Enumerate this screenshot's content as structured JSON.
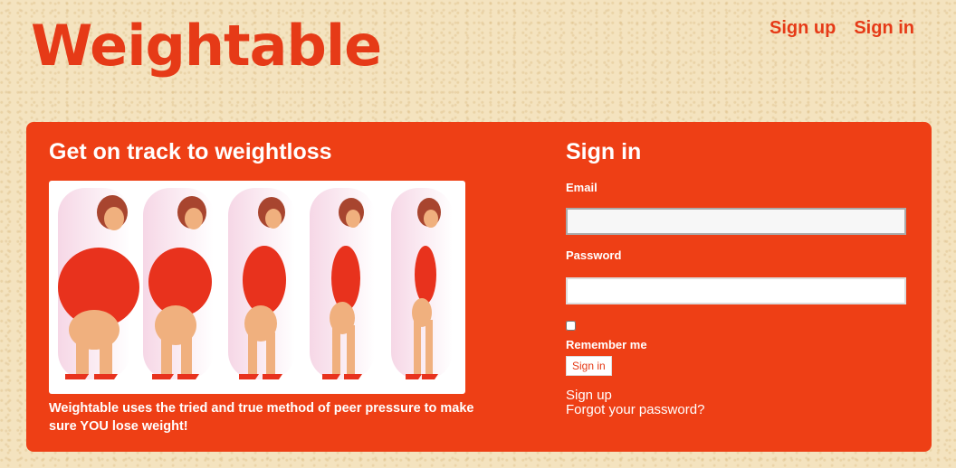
{
  "brand": {
    "name": "Weightable"
  },
  "topnav": {
    "signup": "Sign up",
    "signin": "Sign in"
  },
  "promo": {
    "heading": "Get on track to weightloss",
    "tagline": "Weightable uses the tried and true method of peer pressure to make sure YOU lose weight!"
  },
  "signin": {
    "heading": "Sign in",
    "email_label": "Email",
    "email_value": "",
    "password_label": "Password",
    "password_value": "",
    "remember_label": "Remember me",
    "remember_checked": false,
    "submit_label": "Sign in",
    "signup_link": "Sign up",
    "forgot_link": "Forgot your password?"
  },
  "colors": {
    "accent": "#e63a17",
    "panel": "#ee3f15",
    "background": "#f4e3bf"
  }
}
